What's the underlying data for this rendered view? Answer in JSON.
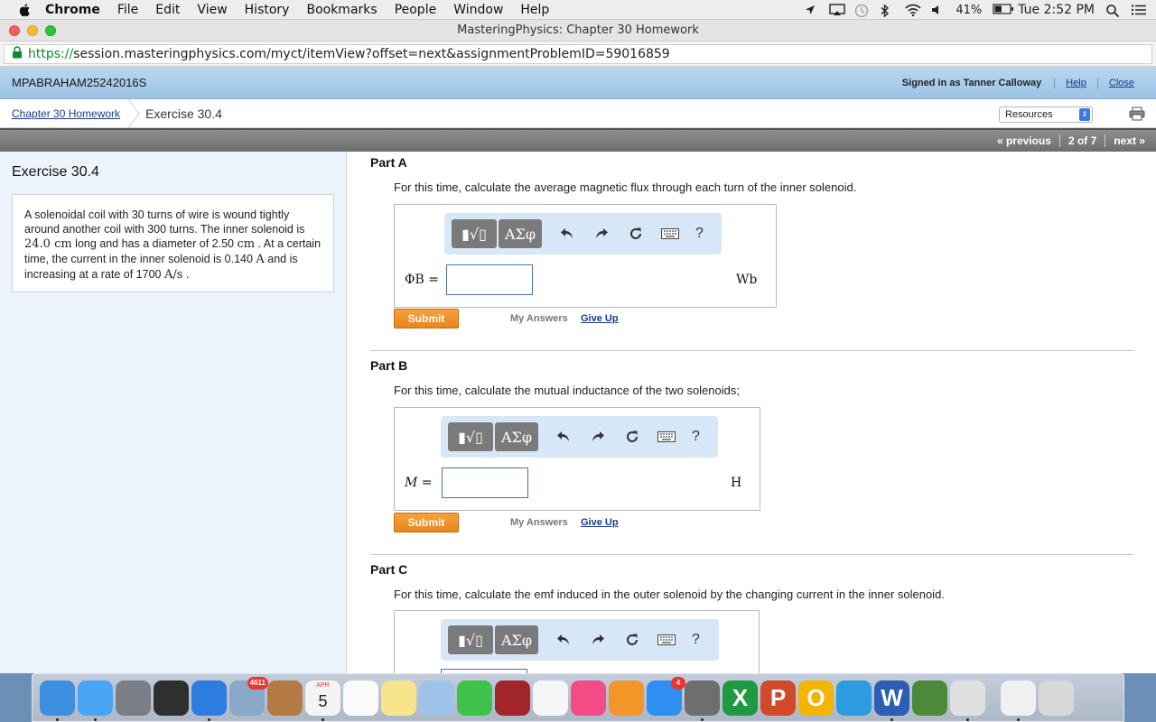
{
  "menubar": {
    "app": "Chrome",
    "items": [
      "File",
      "Edit",
      "View",
      "History",
      "Bookmarks",
      "People",
      "Window",
      "Help"
    ],
    "battery": "41%",
    "clock": "Tue 2:52 PM"
  },
  "window": {
    "title": "MasteringPhysics: Chapter 30 Homework"
  },
  "url": {
    "scheme": "https://",
    "rest": "session.masteringphysics.com/myct/itemView?offset=next&assignmentProblemID=59016859"
  },
  "header": {
    "course_id": "MPABRAHAM25242016S",
    "signed_in": "Signed in as Tanner Calloway",
    "help": "Help",
    "close": "Close"
  },
  "breadcrumb": {
    "assignment": "Chapter 30 Homework",
    "current": "Exercise 30.4"
  },
  "resources": {
    "label": "Resources"
  },
  "nav": {
    "previous": "« previous",
    "position": "2 of 7",
    "next": "next »"
  },
  "exercise": {
    "title": "Exercise 30.4",
    "text_1": "A solenoidal coil with 30 turns of wire is wound tightly around another coil with 300 turns. The inner solenoid is ",
    "len_val": "24.0 cm",
    "text_2": " long and has a diameter of 2.50 ",
    "dia_unit": "cm",
    "text_3": " . At a certain time, the current in the inner solenoid is 0.140 ",
    "cur_unit": "A",
    "text_4": " and is increasing at a rate of 1700 ",
    "rate_unit": "A/s",
    "text_5": " ."
  },
  "toolbar": {
    "templates": "▮√▯",
    "symbols": "ΑΣφ",
    "help": "?"
  },
  "buttons": {
    "submit": "Submit",
    "my_answers": "My Answers",
    "give_up": "Give Up"
  },
  "parts": [
    {
      "title": "Part A",
      "question": "For this time, calculate the average magnetic flux through each turn of the inner solenoid.",
      "var_label": "ΦB =",
      "unit": "Wb"
    },
    {
      "title": "Part B",
      "question": "For this time, calculate the mutual inductance of the two solenoids;",
      "var_label": "M =",
      "unit": "H"
    },
    {
      "title": "Part C",
      "question": "For this time, calculate the emf induced in the outer solenoid by the changing current in the inner solenoid."
    }
  ],
  "dock": {
    "apps": [
      {
        "name": "finder-icon",
        "color": "#3d8fe0"
      },
      {
        "name": "messages-icon",
        "color": "#49a4f5"
      },
      {
        "name": "launchpad-icon",
        "color": "#7a7f87"
      },
      {
        "name": "activity-monitor-icon",
        "color": "#2f2f2f"
      },
      {
        "name": "safari-icon",
        "color": "#2d7de0"
      },
      {
        "name": "mail-icon",
        "color": "#8aa9c8",
        "badge": "4611"
      },
      {
        "name": "contacts-icon",
        "color": "#b37a46"
      },
      {
        "name": "calendar-icon",
        "color": "#f4f4f4",
        "label": "5",
        "month": "APR"
      },
      {
        "name": "reminders-icon",
        "color": "#fafafa"
      },
      {
        "name": "notes-icon",
        "color": "#f6e58a"
      },
      {
        "name": "preview-icon",
        "color": "#9fc2e8"
      },
      {
        "name": "facetime-icon",
        "color": "#3fc24a"
      },
      {
        "name": "photo-booth-icon",
        "color": "#a0262a"
      },
      {
        "name": "photos-icon",
        "color": "#f6f6f6"
      },
      {
        "name": "itunes-icon",
        "color": "#f24b86"
      },
      {
        "name": "ibooks-icon",
        "color": "#f2962a"
      },
      {
        "name": "app-store-icon",
        "color": "#2e8ff0",
        "badge": "4"
      },
      {
        "name": "system-preferences-icon",
        "color": "#6e6e6e"
      },
      {
        "name": "excel-icon",
        "color": "#1f9a40",
        "label": "X"
      },
      {
        "name": "powerpoint-icon",
        "color": "#d04a2a",
        "label": "P"
      },
      {
        "name": "onenote-icon",
        "color": "#f4b400",
        "label": "O"
      },
      {
        "name": "messenger-icon",
        "color": "#2d9be0"
      },
      {
        "name": "word-icon",
        "color": "#2b5fb4",
        "label": "W"
      },
      {
        "name": "xquartz-icon",
        "color": "#4c8a3a"
      },
      {
        "name": "chrome-icon",
        "color": "#e0e0e0"
      },
      {
        "name": "word-document-icon",
        "color": "#f0f0f0"
      },
      {
        "name": "trash-icon",
        "color": "#d8d8d8"
      }
    ]
  }
}
